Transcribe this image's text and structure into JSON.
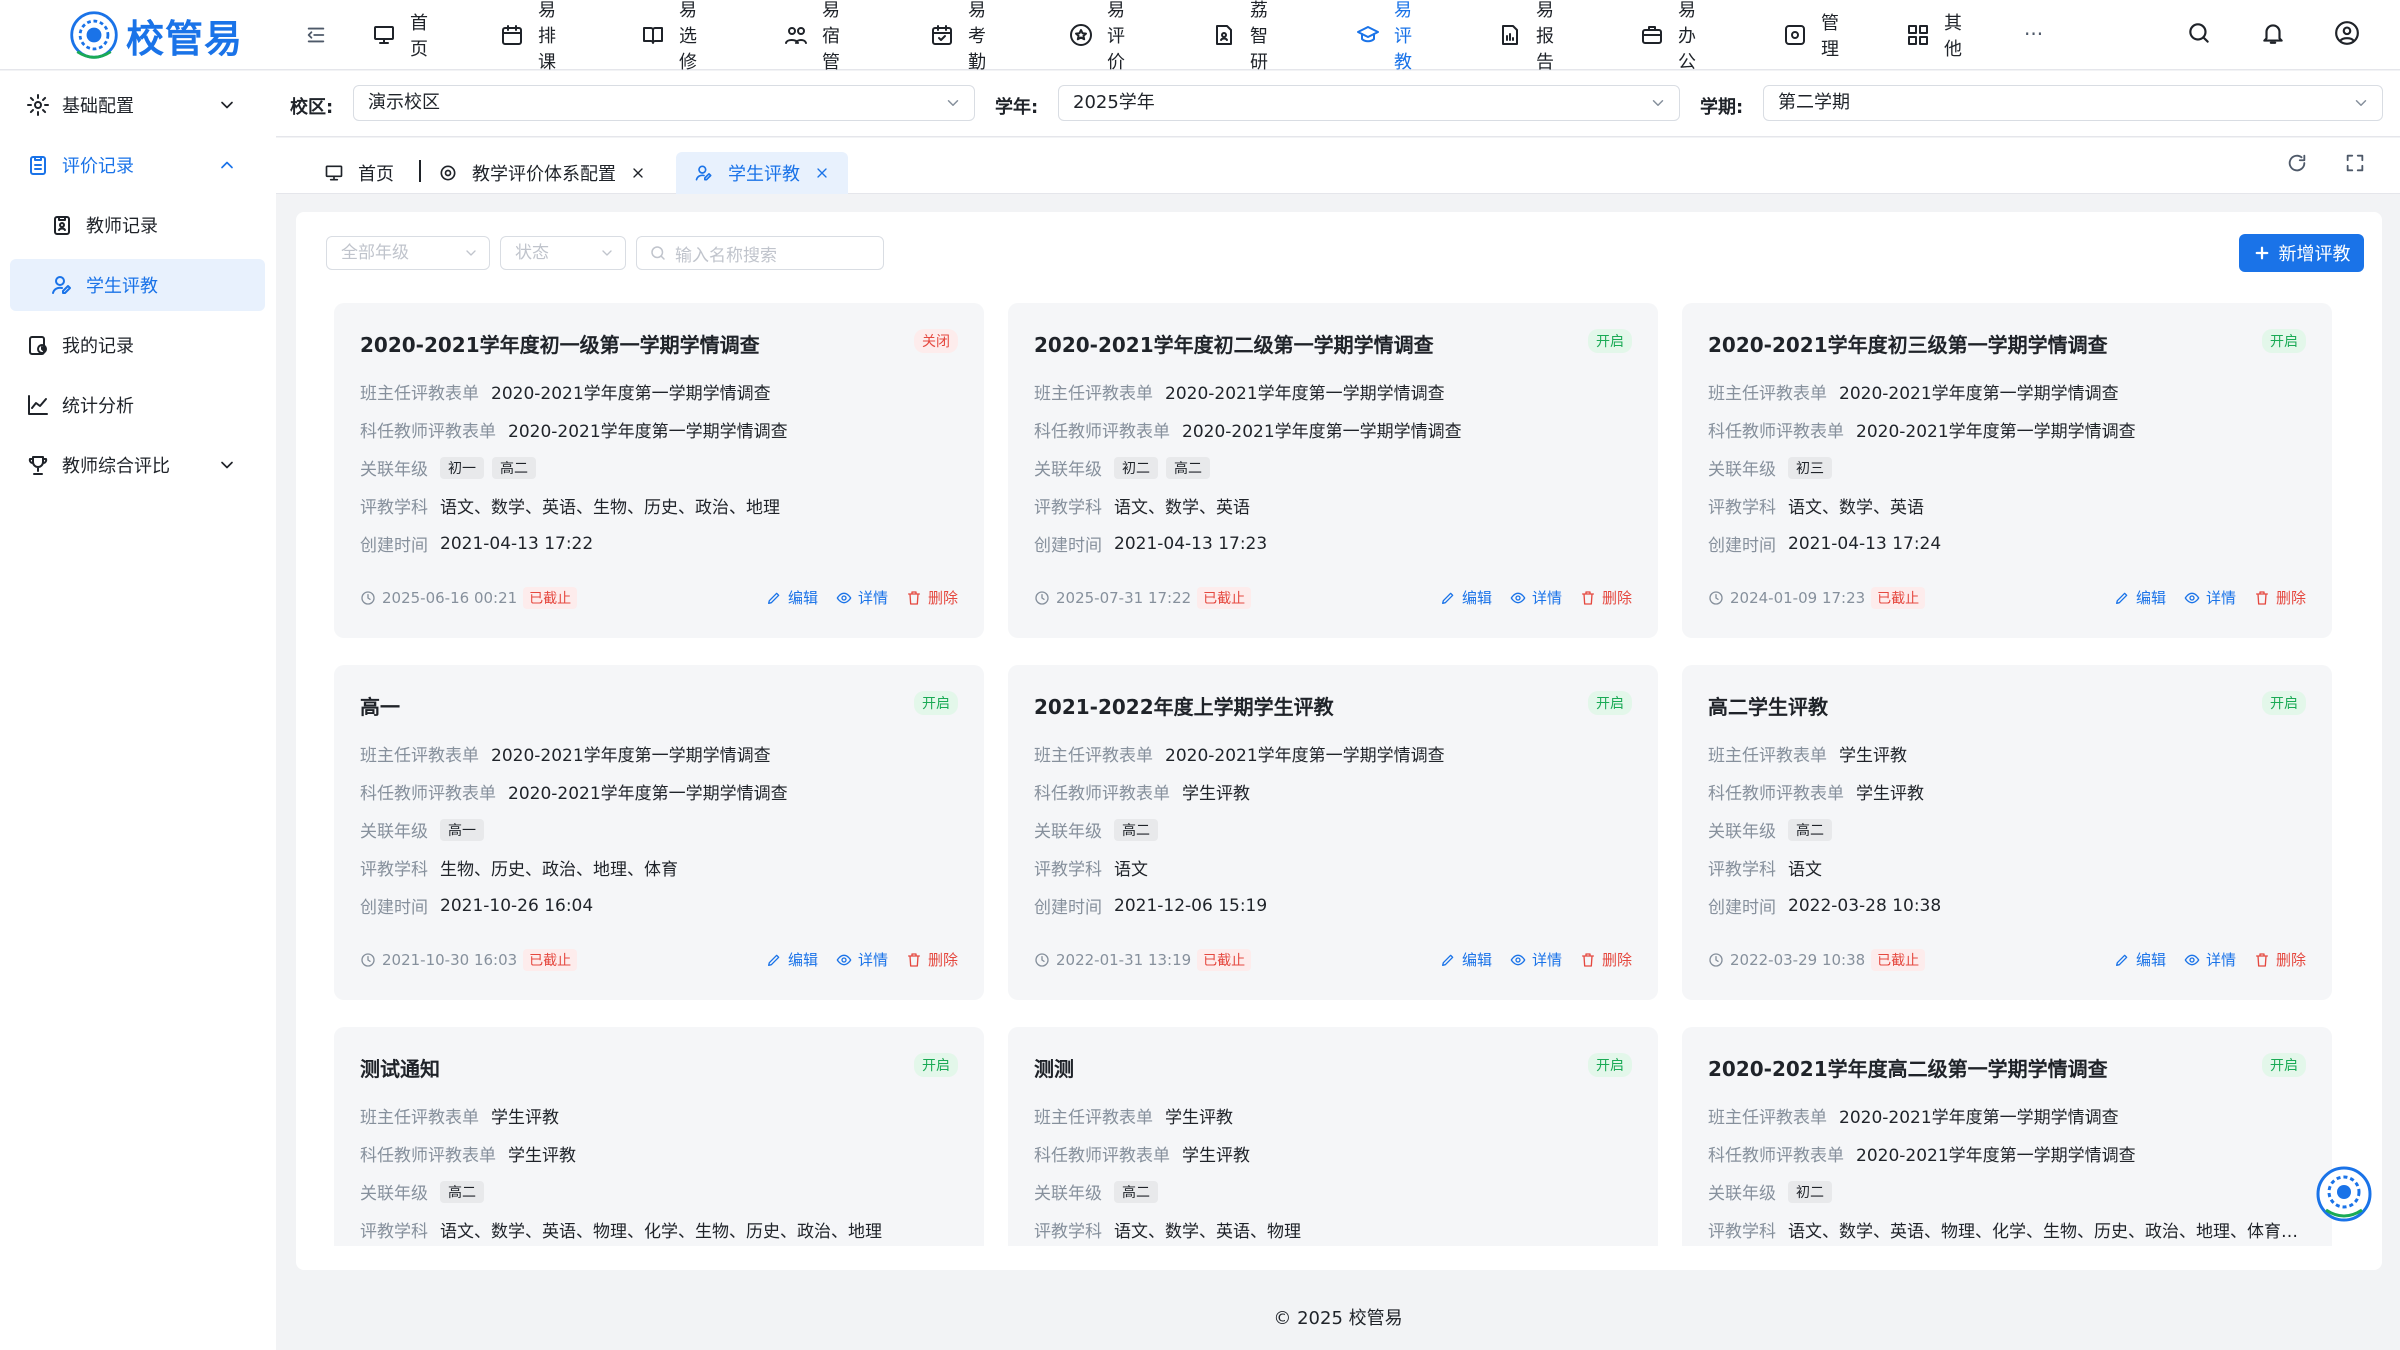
{
  "app": {
    "logo_text": "校管易",
    "footer": "© 2025 校管易"
  },
  "topnav": {
    "items": [
      {
        "label": "首页",
        "icon": "monitor-icon"
      },
      {
        "label": "易排课",
        "icon": "calendar-icon"
      },
      {
        "label": "易选修",
        "icon": "book-icon"
      },
      {
        "label": "易宿管",
        "icon": "people-icon"
      },
      {
        "label": "易考勤",
        "icon": "calendar-check-icon"
      },
      {
        "label": "易评价",
        "icon": "star-icon"
      },
      {
        "label": "荔智研",
        "icon": "doc-user-icon"
      },
      {
        "label": "易评教",
        "icon": "graduation-cap-icon"
      },
      {
        "label": "易报告",
        "icon": "report-icon"
      },
      {
        "label": "易办公",
        "icon": "briefcase-icon"
      },
      {
        "label": "管理",
        "icon": "settings-box-icon"
      },
      {
        "label": "其他",
        "icon": "grid-icon"
      }
    ],
    "more": "···",
    "active": "易评教"
  },
  "sidebar": {
    "items": [
      {
        "label": "基础配置",
        "icon": "gear-icon",
        "expand": "down"
      },
      {
        "label": "评价记录",
        "icon": "clipboard-icon",
        "expand": "up"
      },
      {
        "label": "教师记录",
        "icon": "clipboard-user-icon"
      },
      {
        "label": "学生评教",
        "icon": "user-edit-icon"
      },
      {
        "label": "我的记录",
        "icon": "record-icon"
      },
      {
        "label": "统计分析",
        "icon": "line-chart-icon"
      },
      {
        "label": "教师综合评比",
        "icon": "trophy-icon",
        "expand": "down"
      }
    ]
  },
  "filters": {
    "campus_label": "校区:",
    "campus": "演示校区",
    "year_label": "学年:",
    "year": "2025学年",
    "term_label": "学期:",
    "term": "第二学期"
  },
  "tabs": {
    "home": "首页",
    "config": "教学评价体系配置",
    "current": "学生评教"
  },
  "toolbar": {
    "grade_placeholder": "全部年级",
    "status_placeholder": "状态",
    "search_placeholder": "输入名称搜索",
    "add_label": "新增评教"
  },
  "card_labels": {
    "head_form": "班主任评教表单",
    "subject_form": "科任教师评教表单",
    "grades": "关联年级",
    "subjects": "评教学科",
    "created": "创建时间",
    "expired": "已截止",
    "edit": "编辑",
    "detail": "详情",
    "delete": "删除"
  },
  "cards": [
    {
      "title": "2020-2021学年度初一级第一学期学情调查",
      "status": "关闭",
      "head_form": "2020-2021学年度第一学期学情调查",
      "subject_form": "2020-2021学年度第一学期学情调查",
      "grades": [
        "初一",
        "高二"
      ],
      "subjects": "语文、数学、英语、生物、历史、政治、地理",
      "created": "2021-04-13 17:22",
      "deadline": "2025-06-16 00:21"
    },
    {
      "title": "2020-2021学年度初二级第一学期学情调查",
      "status": "开启",
      "head_form": "2020-2021学年度第一学期学情调查",
      "subject_form": "2020-2021学年度第一学期学情调查",
      "grades": [
        "初二",
        "高二"
      ],
      "subjects": "语文、数学、英语",
      "created": "2021-04-13 17:23",
      "deadline": "2025-07-31 17:22"
    },
    {
      "title": "2020-2021学年度初三级第一学期学情调查",
      "status": "开启",
      "head_form": "2020-2021学年度第一学期学情调查",
      "subject_form": "2020-2021学年度第一学期学情调查",
      "grades": [
        "初三"
      ],
      "subjects": "语文、数学、英语",
      "created": "2021-04-13 17:24",
      "deadline": "2024-01-09 17:23"
    },
    {
      "title": "高一",
      "status": "开启",
      "head_form": "2020-2021学年度第一学期学情调查",
      "subject_form": "2020-2021学年度第一学期学情调查",
      "grades": [
        "高一"
      ],
      "subjects": "生物、历史、政治、地理、体育",
      "created": "2021-10-26 16:04",
      "deadline": "2021-10-30 16:03"
    },
    {
      "title": "2021-2022年度上学期学生评教",
      "status": "开启",
      "head_form": "2020-2021学年度第一学期学情调查",
      "subject_form": "学生评教",
      "grades": [
        "高二"
      ],
      "subjects": "语文",
      "created": "2021-12-06 15:19",
      "deadline": "2022-01-31 13:19"
    },
    {
      "title": "高二学生评教",
      "status": "开启",
      "head_form": "学生评教",
      "subject_form": "学生评教",
      "grades": [
        "高二"
      ],
      "subjects": "语文",
      "created": "2022-03-28 10:38",
      "deadline": "2022-03-29 10:38"
    },
    {
      "title": "测试通知",
      "status": "开启",
      "head_form": "学生评教",
      "subject_form": "学生评教",
      "grades": [
        "高二"
      ],
      "subjects": "语文、数学、英语、物理、化学、生物、历史、政治、地理"
    },
    {
      "title": "测测",
      "status": "开启",
      "head_form": "学生评教",
      "subject_form": "学生评教",
      "grades": [
        "高二"
      ],
      "subjects": "语文、数学、英语、物理"
    },
    {
      "title": "2020-2021学年度高二级第一学期学情调查",
      "status": "开启",
      "head_form": "2020-2021学年度第一学期学情调查",
      "subject_form": "2020-2021学年度第一学期学情调查",
      "grades": [
        "初二"
      ],
      "subjects": "语文、数学、英语、物理、化学、生物、历史、政治、地理、体育、音..."
    }
  ],
  "colors": {
    "primary": "#1a73e8",
    "open": "#1aaa55",
    "closed": "#e5483f"
  }
}
